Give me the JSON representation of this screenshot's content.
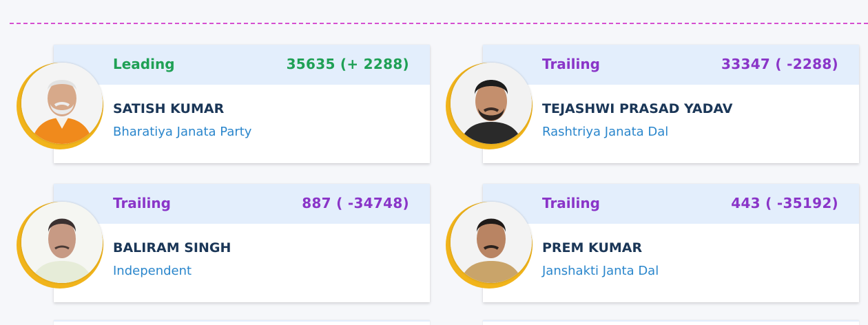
{
  "candidates": [
    {
      "status": "Leading",
      "votes": "35635 (+ 2288)",
      "name": "SATISH KUMAR",
      "party": "Bharatiya Janata Party"
    },
    {
      "status": "Trailing",
      "votes": "33347 ( -2288)",
      "name": "TEJASHWI PRASAD YADAV",
      "party": "Rashtriya Janata Dal"
    },
    {
      "status": "Trailing",
      "votes": "887 ( -34748)",
      "name": "BALIRAM SINGH",
      "party": "Independent"
    },
    {
      "status": "Trailing",
      "votes": "443 ( -35192)",
      "name": "PREM KUMAR",
      "party": "Janshakti Janta Dal"
    }
  ],
  "colors": {
    "leading": "#1fa055",
    "trailing": "#8a35c8",
    "name": "#1a3657",
    "party": "#2a86cc",
    "header_bg": "#e3eefc",
    "ring": "#f1b41b"
  }
}
